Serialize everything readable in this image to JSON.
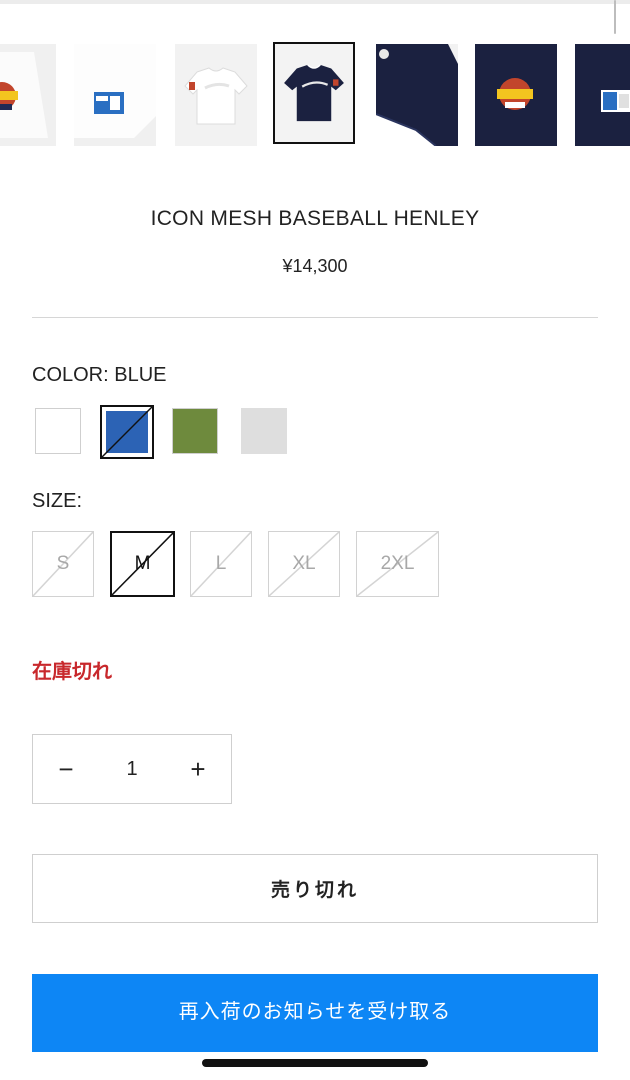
{
  "colors": {
    "accent_blue": "#0d86f5",
    "soldout_red": "#c8282c",
    "swatch_white": "#ffffff",
    "swatch_blue": "#2c63b5",
    "swatch_green": "#6e8a3d",
    "swatch_gray": "#dedede"
  },
  "gallery": {
    "selected_index": 3,
    "thumbnails": [
      {
        "name": "thumb-white-chest-logo-detail"
      },
      {
        "name": "thumb-white-size-label"
      },
      {
        "name": "thumb-white-jersey-front"
      },
      {
        "name": "thumb-navy-jersey-front"
      },
      {
        "name": "thumb-navy-jersey-back"
      },
      {
        "name": "thumb-navy-chest-logo-detail"
      },
      {
        "name": "thumb-navy-size-label"
      },
      {
        "name": "thumb-navy-jersey-partial"
      }
    ]
  },
  "product": {
    "title": "ICON MESH BASEBALL HENLEY",
    "price": "¥14,300"
  },
  "color_option": {
    "label": "COLOR: BLUE",
    "selected": "BLUE",
    "swatches": [
      {
        "name": "white",
        "color": "#ffffff",
        "selected": false,
        "unavailable": false
      },
      {
        "name": "blue",
        "color": "#2c63b5",
        "selected": true,
        "unavailable": true
      },
      {
        "name": "green",
        "color": "#6e8a3d",
        "selected": false,
        "unavailable": false
      },
      {
        "name": "gray",
        "color": "#dedede",
        "selected": false,
        "unavailable": false
      }
    ]
  },
  "size_option": {
    "label": "SIZE:",
    "sizes": [
      {
        "label": "S",
        "selected": false,
        "unavailable": true
      },
      {
        "label": "M",
        "selected": true,
        "unavailable": true
      },
      {
        "label": "L",
        "selected": false,
        "unavailable": true
      },
      {
        "label": "XL",
        "selected": false,
        "unavailable": true
      },
      {
        "label": "2XL",
        "selected": false,
        "unavailable": true
      }
    ]
  },
  "stock_status": "在庫切れ",
  "quantity": {
    "minus": "−",
    "value": "1",
    "plus": "+"
  },
  "buttons": {
    "sold_out": "売り切れ",
    "restock_notify": "再入荷のお知らせを受け取る"
  }
}
